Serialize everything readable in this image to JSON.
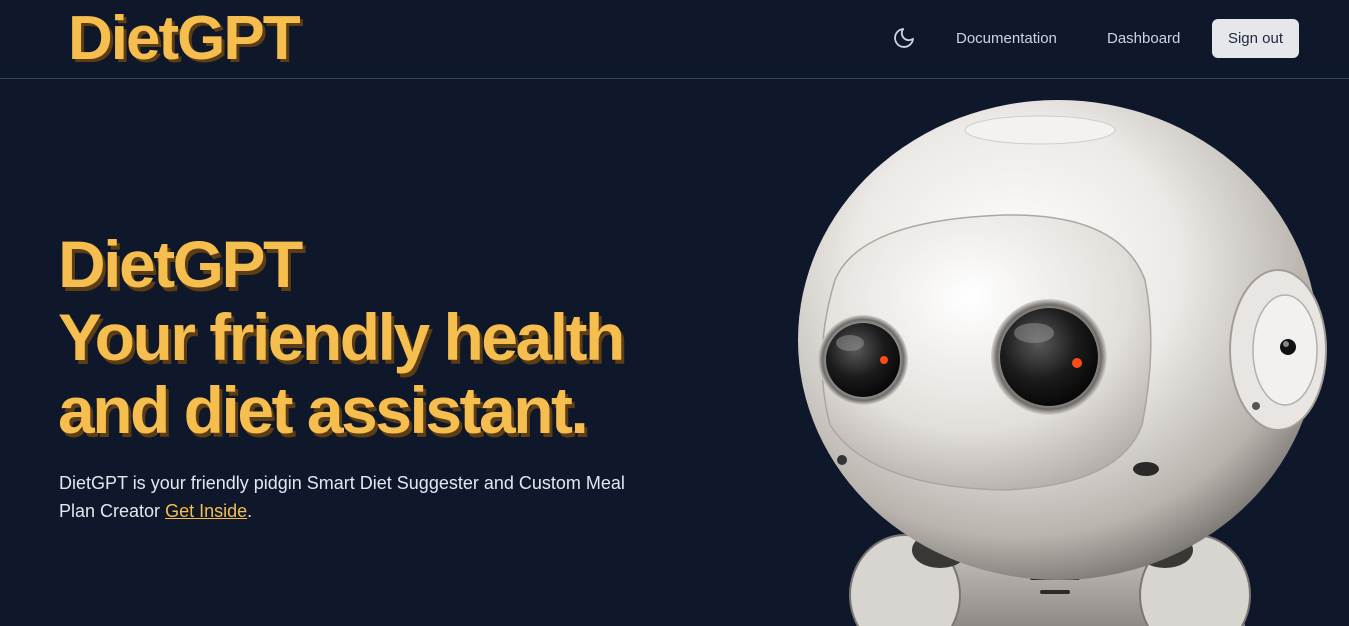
{
  "header": {
    "logo": "DietGPT",
    "theme_icon": "moon-icon",
    "nav": {
      "documentation": "Documentation",
      "dashboard": "Dashboard"
    },
    "signout_label": "Sign out"
  },
  "hero": {
    "title_line1": "DietGPT",
    "title_line2": "Your friendly health",
    "title_line3": "and diet assistant.",
    "description_prefix": "DietGPT is your friendly pidgin Smart Diet Suggester and Custom Meal Plan Creator ",
    "description_link": "Get Inside",
    "description_suffix": ".",
    "image_icon": "robot-illustration"
  },
  "colors": {
    "background": "#0f172a",
    "accent": "#f6bd4f",
    "accent_shadow": "#5c3d14",
    "button_bg": "#e5e7eb"
  }
}
